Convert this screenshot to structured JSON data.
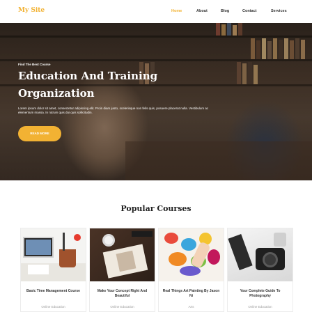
{
  "header": {
    "logo": "My Site",
    "nav": [
      "Home",
      "About",
      "Blog",
      "Contact",
      "Services"
    ]
  },
  "hero": {
    "kicker": "Find The Best Course",
    "title": "Education And Training Organization",
    "text": "Lorem ipsum dolor sit amet, consectetur adipiscing elit. Proin diam justo, scelerisque non felis quis, posuere placerat nulla. Vestibulum ac elementum massa. In rutrum quis dui quis sollicitudin.",
    "button": "READ MORE"
  },
  "courses": {
    "heading": "Popular Courses",
    "items": [
      {
        "title": "Basic Time Management Course",
        "category": "Online Education"
      },
      {
        "title": "Make Your Concept Right And Beautiful",
        "category": "Online Education"
      },
      {
        "title": "Real Things Art Painting By Jason Ni",
        "category": "Arts"
      },
      {
        "title": "Your Complete Guide To Photography",
        "category": "Online Education"
      }
    ]
  },
  "colors": {
    "accent": "#f2b233"
  }
}
